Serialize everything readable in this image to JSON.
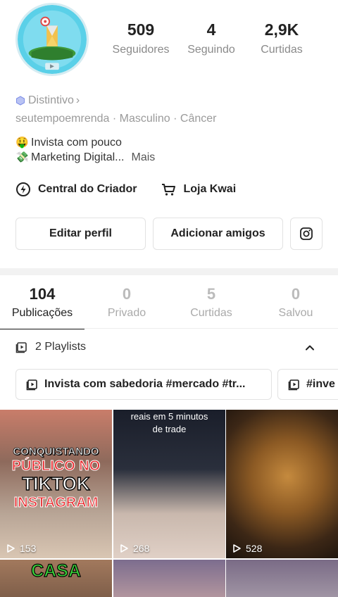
{
  "profile": {
    "stats": [
      {
        "value": "509",
        "label": "Seguidores"
      },
      {
        "value": "4",
        "label": "Seguindo"
      },
      {
        "value": "2,9K",
        "label": "Curtidas"
      }
    ],
    "badge_label": "Distintivo",
    "badge_chevron": "›",
    "meta": [
      "seutempoemrenda",
      "Masculino",
      "Câncer"
    ],
    "meta_separator": " · ",
    "bio_lines": [
      {
        "emoji": "🤑",
        "text": "Invista com pouco"
      },
      {
        "emoji": "💸",
        "text": "Marketing Digital..."
      }
    ],
    "bio_more": "Mais",
    "links": [
      {
        "label": "Central do Criador",
        "icon": "lightning-circle-icon"
      },
      {
        "label": "Loja Kwai",
        "icon": "cart-icon"
      }
    ],
    "actions": {
      "edit": "Editar perfil",
      "add_friends": "Adicionar amigos",
      "instagram_icon": "instagram-icon"
    }
  },
  "tabs": [
    {
      "count": "104",
      "label": "Publicações",
      "active": true
    },
    {
      "count": "0",
      "label": "Privado",
      "active": false
    },
    {
      "count": "5",
      "label": "Curtidas",
      "active": false
    },
    {
      "count": "0",
      "label": "Salvou",
      "active": false
    }
  ],
  "playlists": {
    "label": "2 Playlists",
    "chips": [
      "Invista com sabedoria #mercado #tr...",
      "#inve"
    ]
  },
  "grid": {
    "tiles": [
      {
        "views": "153",
        "overlay": [
          "CONQUISTANDO",
          "PÚBLICO NO",
          "TIKTOK",
          "INSTAGRAM"
        ]
      },
      {
        "views": "268",
        "overlay": [
          "reais em 5 minutos",
          "de trade"
        ]
      },
      {
        "views": "528",
        "overlay": []
      },
      {
        "views": "",
        "overlay": [
          "CASA"
        ]
      },
      {
        "views": "",
        "overlay": []
      },
      {
        "views": "",
        "overlay": []
      }
    ]
  },
  "colors": {
    "accent_text": "#222222",
    "muted_text": "#9a9a9a",
    "border": "#e2e2e2",
    "divider": "#f2f2f2"
  }
}
